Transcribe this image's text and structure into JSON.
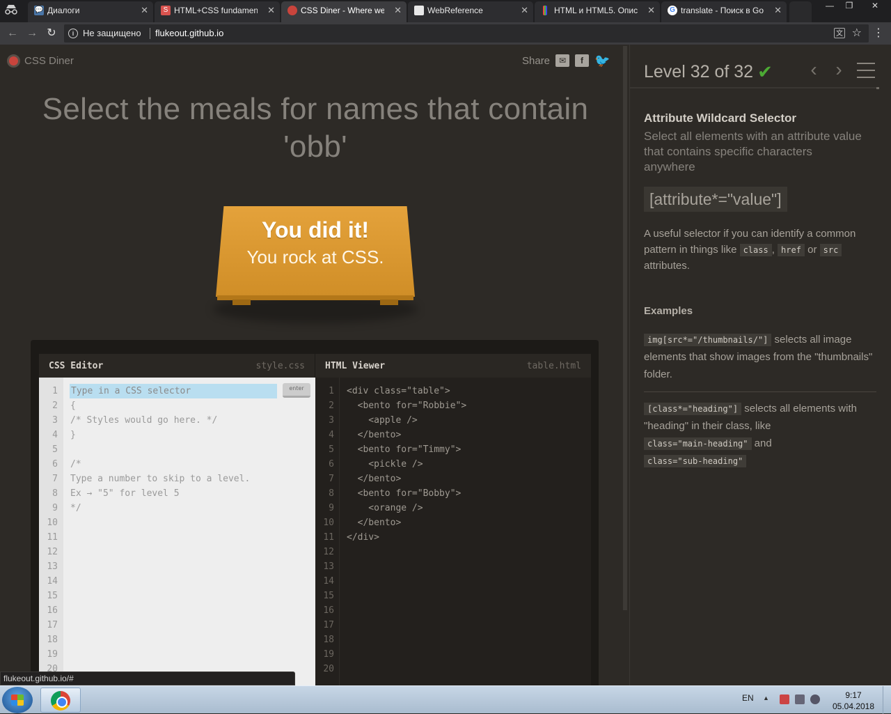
{
  "browser": {
    "tabs": [
      {
        "title": "Диалоги",
        "favicon_color": "#4a76a8",
        "favicon_glyph": "💬",
        "active": false
      },
      {
        "title": "HTML+CSS fundament",
        "favicon_color": "#d9534f",
        "favicon_glyph": "S",
        "active": false
      },
      {
        "title": "CSS Diner - Where we",
        "favicon_color": "#c9443c",
        "favicon_glyph": "●",
        "active": true
      },
      {
        "title": "WebReference",
        "favicon_color": "#e8e8e8",
        "favicon_glyph": "■",
        "active": false
      },
      {
        "title": "HTML и HTML5. Опис",
        "favicon_color": "#3fb3c5",
        "favicon_glyph": "|",
        "active": false
      },
      {
        "title": "translate - Поиск в Go",
        "favicon_color": "#ffffff",
        "favicon_glyph": "G",
        "active": false
      }
    ],
    "security_label": "Не защищено",
    "url": "flukeout.github.io"
  },
  "page": {
    "logo_text": "CSS Diner",
    "share_label": "Share",
    "instruction": "Select the meals for names that contain 'obb'",
    "win_title": "You did it!",
    "win_subtitle": "You rock at CSS.",
    "css_editor": {
      "title": "CSS Editor",
      "filename": "style.css",
      "input_placeholder": "Type in a CSS selector",
      "enter_label": "enter",
      "lines": [
        "",
        "{",
        "/* Styles would go here. */",
        "}",
        "",
        "/*",
        "Type a number to skip to a level.",
        "Ex → \"5\" for level 5",
        "*/",
        "",
        "",
        "",
        "",
        "",
        "",
        "",
        "",
        "",
        "",
        ""
      ]
    },
    "html_viewer": {
      "title": "HTML Viewer",
      "filename": "table.html",
      "lines": [
        "<div class=\"table\">",
        "  <bento for=\"Robbie\">",
        "    <apple />",
        "  </bento>",
        "  <bento for=\"Timmy\">",
        "    <pickle />",
        "  </bento>",
        "  <bento for=\"Bobby\">",
        "    <orange />",
        "  </bento>",
        "</div>",
        "",
        "",
        "",
        "",
        "",
        "",
        "",
        "",
        ""
      ]
    },
    "status_url": "flukeout.github.io/#"
  },
  "sidebar": {
    "level_text": "Level 32 of 32",
    "check": "✔",
    "selector_name": "Attribute Wildcard Selector",
    "description": "Select all elements with an attribute value that contains specific characters anywhere",
    "syntax": "[attribute*=\"value\"]",
    "help_before": "A useful selector if you can identify a common pattern in things like ",
    "help_chip1": "class",
    "help_comma": ",",
    "help_chip2": "href",
    "help_or": " or ",
    "help_chip3": "src",
    "help_after": "attributes.",
    "examples_title": "Examples",
    "example1_code": "img[src*=\"/thumbnails/\"]",
    "example1_text": " selects all image elements that show images from the \"thumbnails\" folder.",
    "example2_code": "[class*=\"heading\"]",
    "example2_text": " selects all elements with \"heading\" in their class, like ",
    "example2_chip1": "class=\"main-heading\"",
    "example2_and": " and ",
    "example2_chip2": "class=\"sub-heading\""
  },
  "taskbar": {
    "lang": "EN",
    "time": "9:17",
    "date": "05.04.2018"
  }
}
